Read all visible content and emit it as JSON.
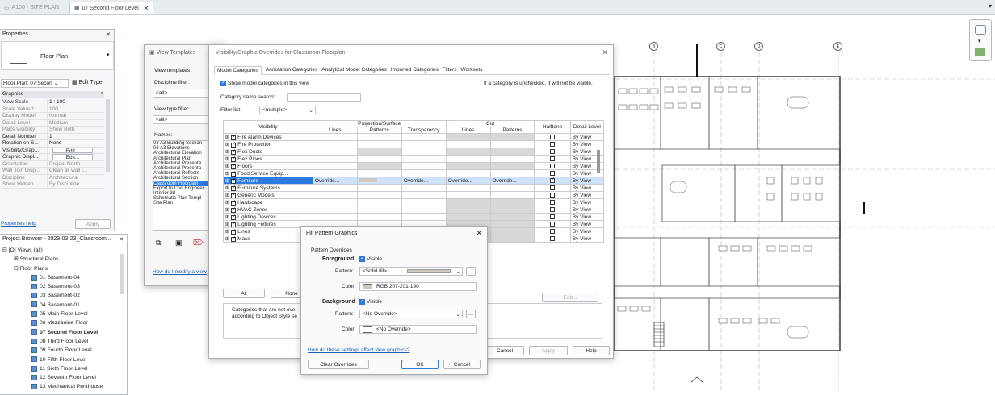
{
  "tabs": [
    {
      "label": "A100 - SITE PLAN"
    },
    {
      "label": "07 Second Floor Level"
    }
  ],
  "properties": {
    "title": "Properties",
    "type_name": "Floor Plan",
    "selector": "Floor Plan: 07 Secon",
    "edit_type": "Edit Type",
    "section": "Graphics",
    "rows": [
      {
        "k": "View Scale",
        "v": "1 : 100"
      },
      {
        "k": "Scale Value   1:",
        "v": "100"
      },
      {
        "k": "Display Model",
        "v": "Normal"
      },
      {
        "k": "Detail Level",
        "v": "Medium"
      },
      {
        "k": "Parts Visibility",
        "v": "Show Both"
      },
      {
        "k": "Detail Number",
        "v": "1"
      },
      {
        "k": "Rotation on S...",
        "v": "None"
      },
      {
        "k": "Visibility/Grap...",
        "v": "Edit..."
      },
      {
        "k": "Graphic Displ...",
        "v": "Edit..."
      },
      {
        "k": "Orientation",
        "v": "Project North"
      },
      {
        "k": "Wall Join Disp...",
        "v": "Clean all wall j..."
      },
      {
        "k": "Discipline",
        "v": "Architectural"
      },
      {
        "k": "Show Hidden ...",
        "v": "By Discipline"
      }
    ],
    "help": "Properties help",
    "apply": "Apply"
  },
  "browser": {
    "title": "Project Browser - 2023-03-23_Classroom...",
    "views": "Views (all)",
    "structural": "Structural Plans",
    "floor": "Floor Plans",
    "items": [
      "01 Basement-04",
      "02 Basement-03",
      "03 Basement-02",
      "04 Basement-01",
      "05 Main Floor Level",
      "06 Mezzanine Floor",
      "07 Second Floor Level",
      "08 Third Floor Level",
      "09 Fourth Floor Level",
      "10 Fifth Floor Level",
      "11 Sixth Floor Level",
      "12 Seventh Floor Level",
      "13 Mechanical Penthouse"
    ]
  },
  "view_templates": {
    "title": "View Templates",
    "heading": "View templates",
    "discipline_label": "Discipline filter:",
    "discipline_value": "<all>",
    "type_label": "View type filter:",
    "type_value": "<all>",
    "names_label": "Names:",
    "names": [
      "03 A3 Building Section",
      "03 A3 Elevations",
      "Architectural Elevation",
      "Architectural Plan",
      "Architectural Presenta",
      "Architectural Presenta",
      "Architectural Reflecte",
      "Architectural Section",
      "Classroom Floorplan",
      "Export to Civil Engineer",
      "Interior 3d",
      "Schematic Plan Templ",
      "Site Plan"
    ],
    "help_link": "How do I modify a view"
  },
  "vg": {
    "title": "Visibility/Graphic Overrides for Classroom Floorplan",
    "tabs": [
      "Model Categories",
      "Annotation Categories",
      "Analytical Model Categories",
      "Imported Categories",
      "Filters",
      "Worksets"
    ],
    "show_label": "Show model categories in this view",
    "note": "If a category is unchecked, it will not be visible.",
    "search_label": "Category name search:",
    "filter_label": "Filter list:",
    "filter_value": "<multiple>",
    "headers": {
      "visibility": "Visibility",
      "projection": "Projection/Surface",
      "cut": "Cut",
      "lines": "Lines",
      "patterns": "Patterns",
      "transparency": "Transparency",
      "halftone": "Halftone",
      "detail": "Detail Level"
    },
    "rows": [
      {
        "name": "Fire Alarm Devices",
        "detail": "By View",
        "sel": false
      },
      {
        "name": "Fire Protection",
        "detail": "By View",
        "sel": false
      },
      {
        "name": "Flex Ducts",
        "detail": "By View",
        "sel": false
      },
      {
        "name": "Flex Pipes",
        "detail": "By View",
        "sel": false
      },
      {
        "name": "Floors",
        "detail": "By View",
        "sel": false
      },
      {
        "name": "Food Service Equip...",
        "detail": "By View",
        "sel": false
      },
      {
        "name": "Furniture",
        "detail": "By View",
        "sel": true
      },
      {
        "name": "Furniture Systems",
        "detail": "By View",
        "sel": false
      },
      {
        "name": "Generic Models",
        "detail": "By View",
        "sel": false
      },
      {
        "name": "Hardscape",
        "detail": "By View",
        "sel": false
      },
      {
        "name": "HVAC Zones",
        "detail": "By View",
        "sel": false
      },
      {
        "name": "Lighting Devices",
        "detail": "By View",
        "sel": false
      },
      {
        "name": "Lighting Fixtures",
        "detail": "By View",
        "sel": false
      },
      {
        "name": "Lines",
        "detail": "By View",
        "sel": false
      },
      {
        "name": "Mass",
        "detail": "By View",
        "sel": false
      }
    ],
    "override": "Override...",
    "btn_all": "All",
    "btn_none": "None",
    "edit": "Edit...",
    "footnote1": "Categories that are not ove",
    "footnote2": "according to Object Style se",
    "cancel": "Cancel",
    "apply": "Apply",
    "help": "Help"
  },
  "fpg": {
    "title": "Fill Pattern Graphics",
    "section": "Pattern Overrides",
    "fg_label": "Foreground",
    "visible": "Visible",
    "pattern_label": "Pattern:",
    "fg_pattern": "<Solid fill>",
    "color_label": "Color:",
    "fg_color": "RGB 207-201-190",
    "fg_swatch": "#cfc9be",
    "bg_label": "Background",
    "bg_pattern": "<No Override>",
    "bg_color": "<No Override>",
    "link": "How do these settings affect view graphics?",
    "clear": "Clear Overrides",
    "ok": "OK",
    "cancel": "Cancel"
  },
  "drawing": {
    "grid_bubbles": [
      "B",
      "C",
      "D",
      "E"
    ]
  }
}
